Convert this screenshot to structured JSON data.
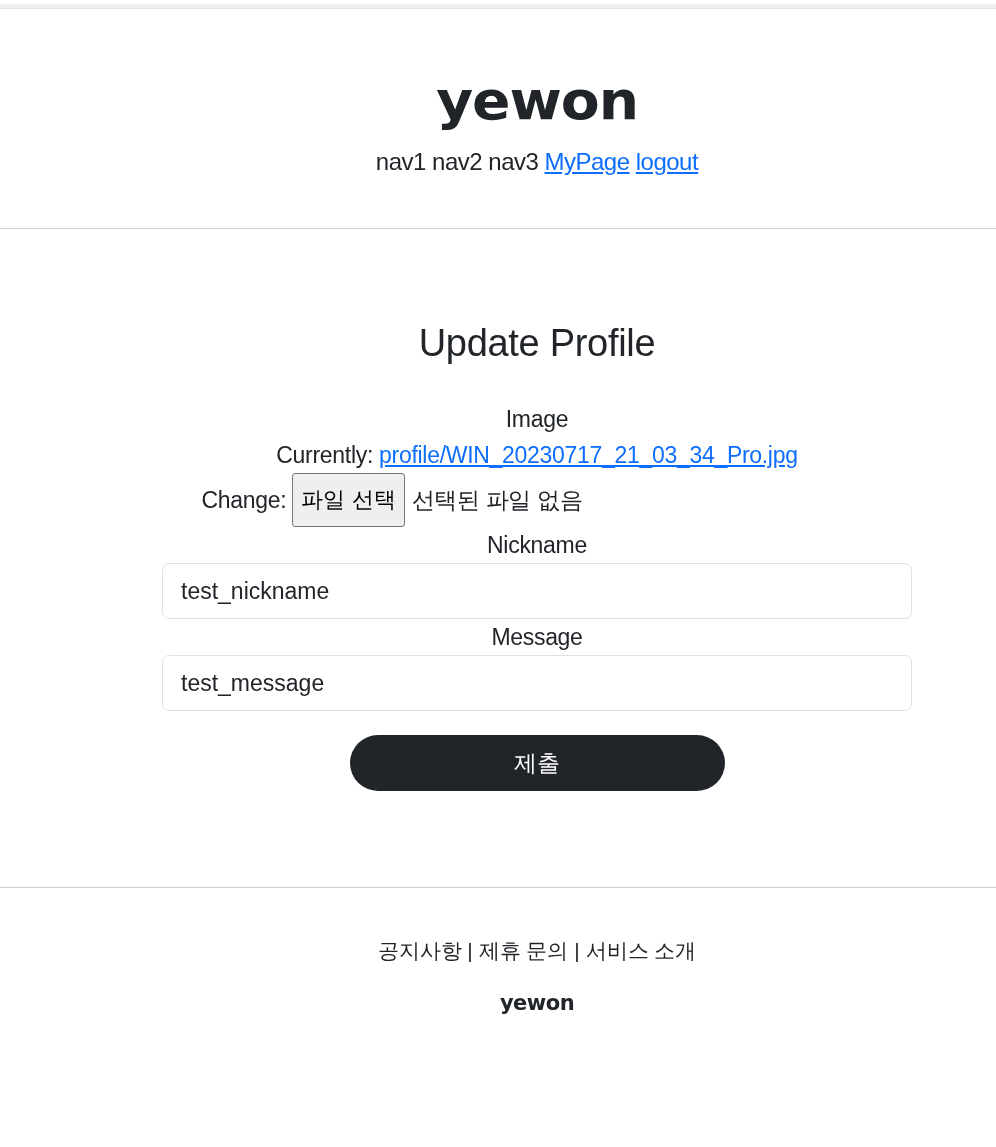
{
  "header": {
    "logo": "yewon",
    "nav": [
      {
        "label": "nav1",
        "kind": "text"
      },
      {
        "label": "nav2",
        "kind": "text"
      },
      {
        "label": "nav3",
        "kind": "text"
      },
      {
        "label": "MyPage",
        "kind": "link"
      },
      {
        "label": "logout",
        "kind": "link"
      }
    ]
  },
  "form": {
    "title": "Update Profile",
    "image": {
      "label": "Image",
      "current_prefix": "Currently:",
      "current_file": "profile/WIN_20230717_21_03_34_Pro.jpg",
      "change_label": "Change:",
      "choose_button": "파일 선택",
      "no_file": "선택된 파일 없음"
    },
    "fields": [
      {
        "label": "Nickname",
        "value": "test_nickname"
      },
      {
        "label": "Message",
        "value": "test_message"
      }
    ],
    "submit": "제출"
  },
  "footer": {
    "links": "공지사항 | 제휴 문의 | 서비스 소개",
    "logo": "yewon"
  }
}
